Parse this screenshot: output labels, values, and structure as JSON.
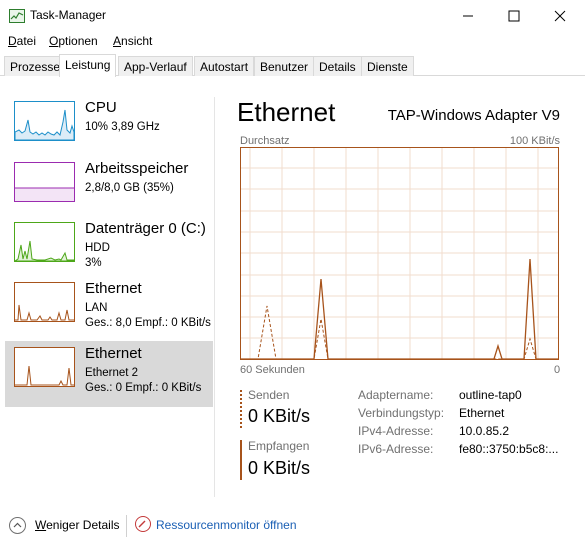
{
  "window": {
    "title": "Task-Manager"
  },
  "menu": [
    {
      "u": "D",
      "rest": "atei"
    },
    {
      "u": "O",
      "rest": "ptionen"
    },
    {
      "u": "A",
      "rest": "nsicht"
    }
  ],
  "tabs": [
    "Prozesse",
    "Leistung",
    "App-Verlauf",
    "Autostart",
    "Benutzer",
    "Details",
    "Dienste"
  ],
  "active_tab": "Leistung",
  "sidebar": [
    {
      "title": "CPU",
      "lines": [
        "10% 3,89 GHz"
      ],
      "color": "#1d8fc9"
    },
    {
      "title": "Arbeitsspeicher",
      "lines": [
        "2,8/8,0 GB (35%)"
      ],
      "color": "#9b2bb0"
    },
    {
      "title": "Datenträger 0 (C:)",
      "lines": [
        "HDD",
        "3%"
      ],
      "color": "#4da719"
    },
    {
      "title": "Ethernet",
      "lines": [
        "LAN",
        "Ges.: 8,0  Empf.: 0 KBit/s"
      ],
      "color": "#a7531b"
    },
    {
      "title": "Ethernet",
      "lines": [
        "Ethernet 2",
        "Ges.: 0  Empf.: 0 KBit/s"
      ],
      "color": "#a7531b",
      "selected": true
    }
  ],
  "detail": {
    "title": "Ethernet",
    "adapter": "TAP-Windows Adapter V9",
    "throughput_label": "Durchsatz",
    "max_label": "100 KBit/s",
    "x_left": "60 Sekunden",
    "x_right": "0",
    "send_label": "Senden",
    "send_value": "0 KBit/s",
    "receive_label": "Empfangen",
    "receive_value": "0 KBit/s",
    "props": [
      {
        "key": "Adaptername:",
        "value": "outline-tap0"
      },
      {
        "key": "Verbindungstyp:",
        "value": "Ethernet"
      },
      {
        "key": "IPv4-Adresse:",
        "value": "10.0.85.2"
      },
      {
        "key": "IPv6-Adresse:",
        "value": "fe80::3750:b5c8:..."
      }
    ],
    "accent": "#a7531b",
    "grid_color": "#f2dccd"
  },
  "footer": {
    "fewer_u": "W",
    "fewer_rest": "eniger Details",
    "resmon": "Ressourcenmonitor öffnen"
  }
}
